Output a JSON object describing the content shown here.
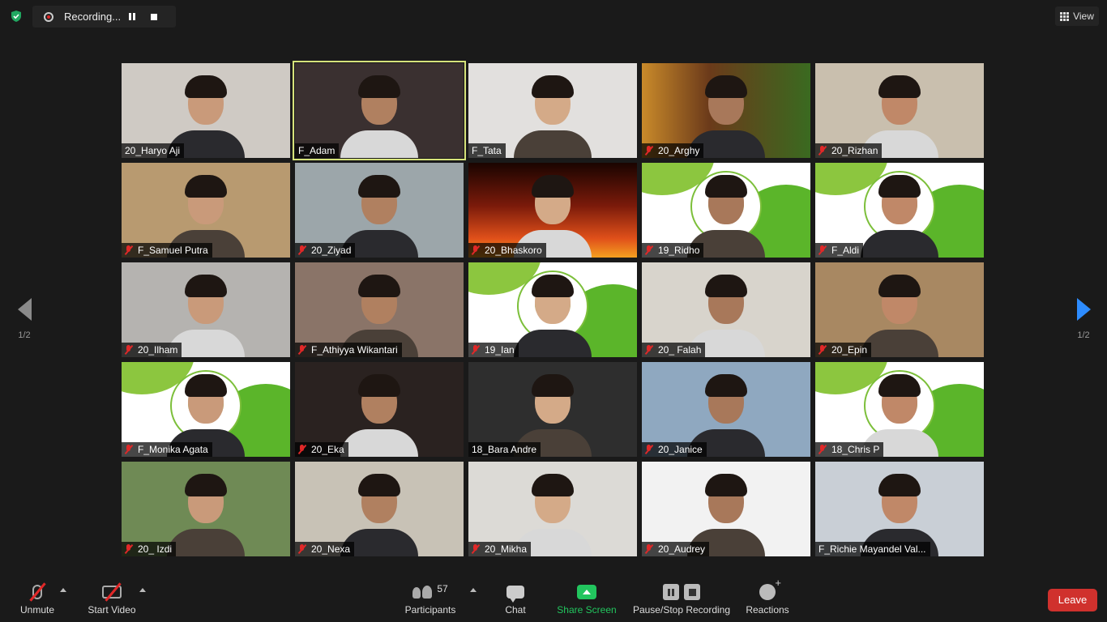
{
  "recording": {
    "label": "Recording..."
  },
  "view_button": {
    "label": "View"
  },
  "pager": {
    "left": "1/2",
    "right": "1/2"
  },
  "colors": {
    "active_border": "#d6e27a",
    "leave": "#d0312d",
    "share_green": "#22c55e",
    "muted_red": "#e02828",
    "next_arrow": "#2d8cff"
  },
  "participants": [
    {
      "name": "20_Haryo Aji",
      "muted": false,
      "active": false,
      "bg": "#cfcac4",
      "scene": "person-dark"
    },
    {
      "name": "F_Adam",
      "muted": false,
      "active": true,
      "bg": "#3a3030",
      "scene": "person-close"
    },
    {
      "name": "F_Tata",
      "muted": false,
      "active": false,
      "bg": "#e2e0de",
      "scene": "person-light"
    },
    {
      "name": "20_Arghy",
      "muted": true,
      "active": false,
      "bg": "#6b4a2a",
      "scene": "burger"
    },
    {
      "name": "20_Rizhan",
      "muted": true,
      "active": false,
      "bg": "#c9bfae",
      "scene": "person-dark"
    },
    {
      "name": "F_Samuel Putra",
      "muted": true,
      "active": false,
      "bg": "#b89a70",
      "scene": "person-close"
    },
    {
      "name": "20_Ziyad",
      "muted": true,
      "active": false,
      "bg": "#9ca6aa",
      "scene": "person-light"
    },
    {
      "name": "20_Bhaskoro",
      "muted": true,
      "active": false,
      "bg": "#7a1a0a",
      "scene": "fire"
    },
    {
      "name": "19_Ridho",
      "muted": true,
      "active": false,
      "bg": "#ffffff",
      "scene": "logo"
    },
    {
      "name": "F_Aldi",
      "muted": true,
      "active": false,
      "bg": "#ffffff",
      "scene": "logo"
    },
    {
      "name": "20_Ilham",
      "muted": true,
      "active": false,
      "bg": "#b5b3b0",
      "scene": "person-light"
    },
    {
      "name": "F_Athiyya Wikantari",
      "muted": true,
      "active": false,
      "bg": "#8a7468",
      "scene": "person-dark"
    },
    {
      "name": "19_Ian",
      "muted": true,
      "active": false,
      "bg": "#ffffff",
      "scene": "logo"
    },
    {
      "name": "20_ Falah",
      "muted": true,
      "active": false,
      "bg": "#d8d4cc",
      "scene": "person-close"
    },
    {
      "name": "20_Epin",
      "muted": true,
      "active": false,
      "bg": "#a88862",
      "scene": "person-dark"
    },
    {
      "name": "F_Monika Agata",
      "muted": true,
      "active": false,
      "bg": "#ffffff",
      "scene": "logo"
    },
    {
      "name": "20_Eka",
      "muted": true,
      "active": false,
      "bg": "#2a2220",
      "scene": "person-dark"
    },
    {
      "name": "18_Bara Andre",
      "muted": false,
      "active": false,
      "bg": "#2e2e2e",
      "scene": "person-close"
    },
    {
      "name": "20_Janice",
      "muted": true,
      "active": false,
      "bg": "#8fa8c0",
      "scene": "person-light"
    },
    {
      "name": "18_Chris P",
      "muted": true,
      "active": false,
      "bg": "#ffffff",
      "scene": "logo"
    },
    {
      "name": "20_ Izdi",
      "muted": true,
      "active": false,
      "bg": "#6f8a55",
      "scene": "person-dark"
    },
    {
      "name": "20_Nexa",
      "muted": true,
      "active": false,
      "bg": "#c8c2b6",
      "scene": "person-dark"
    },
    {
      "name": "20_Mikha",
      "muted": true,
      "active": false,
      "bg": "#dcdad6",
      "scene": "person-close"
    },
    {
      "name": "20_Audrey",
      "muted": true,
      "active": false,
      "bg": "#f2f2f2",
      "scene": "person-light"
    },
    {
      "name": "F_Richie Mayandel Val...",
      "muted": false,
      "active": false,
      "bg": "#c9cfd6",
      "scene": "person-close"
    }
  ],
  "toolbar": {
    "unmute": "Unmute",
    "start_video": "Start Video",
    "participants": "Participants",
    "participant_count": "57",
    "chat": "Chat",
    "share_screen": "Share Screen",
    "pause_stop_recording": "Pause/Stop Recording",
    "reactions": "Reactions",
    "leave": "Leave"
  }
}
